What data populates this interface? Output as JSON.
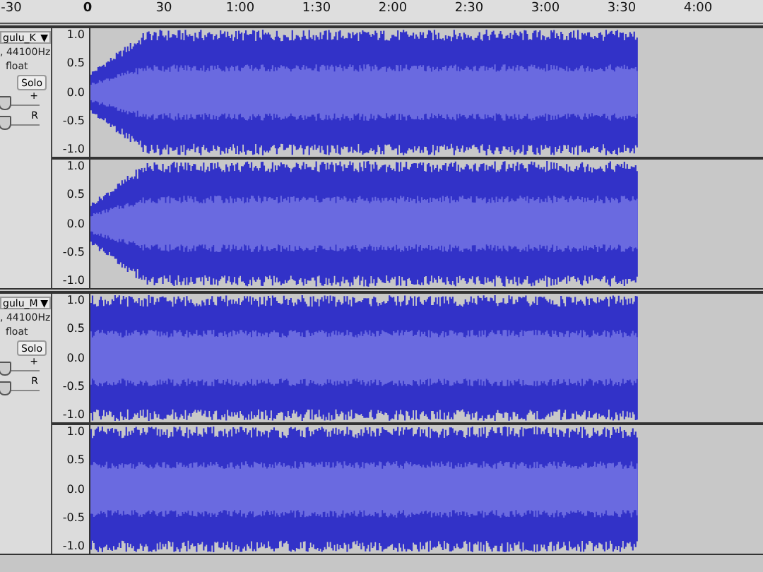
{
  "ruler": {
    "ticks": [
      "-30",
      "0",
      "30",
      "1:00",
      "1:30",
      "2:00",
      "2:30",
      "3:00",
      "3:30",
      "4:00"
    ]
  },
  "tracks": [
    {
      "name": "gulu_K",
      "menu_arrow": "▼",
      "info": ", 44100Hz",
      "format": "float",
      "solo": "Solo",
      "gain": {
        "label": "+",
        "level": 0.08
      },
      "pan": {
        "label": "R",
        "level": 0.08
      },
      "fade_in": true,
      "channels": [
        {
          "scale": [
            "1.0",
            "0.5",
            "0.0",
            "-0.5",
            "-1.0"
          ]
        },
        {
          "scale": [
            "1.0",
            "0.5",
            "0.0",
            "-0.5",
            "-1.0"
          ]
        }
      ]
    },
    {
      "name": "gulu_M",
      "menu_arrow": "▼",
      "info": ", 44100Hz",
      "format": "float",
      "solo": "Solo",
      "gain": {
        "label": "+",
        "level": 0.08
      },
      "pan": {
        "label": "R",
        "level": 0.08
      },
      "fade_in": false,
      "channels": [
        {
          "scale": [
            "1.0",
            "0.5",
            "0.0",
            "-0.5",
            "-1.0"
          ]
        },
        {
          "scale": [
            "1.0",
            "0.5",
            "0.0",
            "-0.5",
            "-1.0"
          ]
        }
      ]
    }
  ]
}
